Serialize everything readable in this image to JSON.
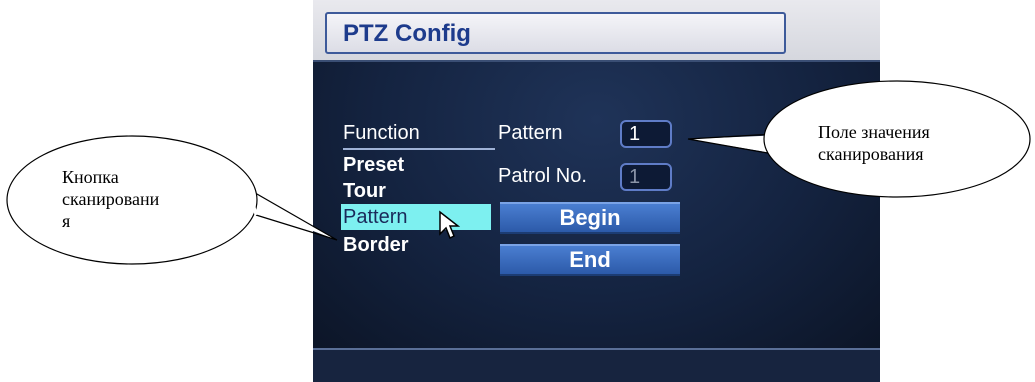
{
  "dialog": {
    "title": "PTZ Config",
    "function_label": "Function",
    "menu": [
      "Preset",
      "Tour",
      "Pattern",
      "Border"
    ],
    "selected_index": 2,
    "pattern_label": "Pattern",
    "pattern_value": "1",
    "patrol_label": "Patrol No.",
    "patrol_value": "1",
    "begin_label": "Begin",
    "end_label": "End"
  },
  "callouts": {
    "left_line1": "Кнопка",
    "left_line2": "сканировани",
    "left_line3": "я",
    "right_line1": "Поле значения",
    "right_line2": "сканирования"
  },
  "colors": {
    "panel_bg": "#142340",
    "selected_bg": "#7df0f0",
    "button_bg": "#3a6cc0",
    "title_text": "#1d3b8c"
  }
}
